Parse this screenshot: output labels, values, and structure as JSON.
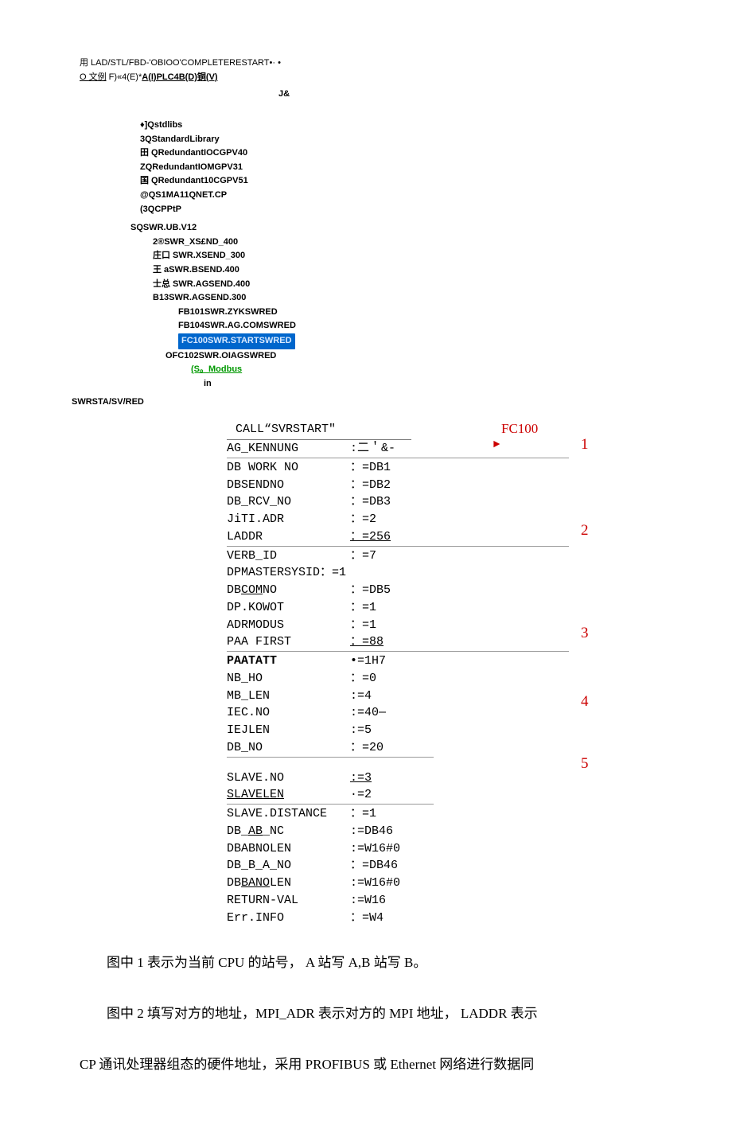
{
  "header": {
    "line1": "用 LAD/STL/FBD-'OBIOO'COMPLETERESTART•·  •",
    "line2_pre": "O 文例",
    "line2_mid": " F)«4(E)*",
    "line2_bold": "A(I)PLC4B(D)铜(V)",
    "jamp": "J&"
  },
  "tree": {
    "l1": "♦]Qstdlibs",
    "l2": "3QStandardLibrary",
    "l3": "田 QRedundantIOCGPV40",
    "l4": "ZQRedundantIOMGPV31",
    "l5": "国 QRedundant10CGPV51",
    "l6": "@QS1MA11QNET.CP",
    "l7": "(3QCPPtP",
    "l8": "SQSWR.UB.V12",
    "l9": "2®SWR_XS£ND_400",
    "l10": "庄口 SWR.XSEND_300",
    "l11": "王 aSWR.BSEND.400",
    "l12": "士总 SWR.AGSEND.400",
    "l13": "B13SWR.AGSEND.300",
    "l14": "FB101SWR.ZYKSWRED",
    "l15": "FB104SWR.AG.COMSWRED",
    "l16": "FC100SWR.STARTSWRED",
    "l17": "OFC102SWR.OIAGSWRED",
    "l18": "(S。Modbus",
    "l19": "in",
    "swr_line": "SWRSTA/SV/RED"
  },
  "code": {
    "fc100": "FC100",
    "call": "CALL“SVRSTART″",
    "rows": [
      {
        "name": "AG_KENNUNG",
        "val": ":二＇&-",
        "ann": "1",
        "arrow": true
      },
      {
        "name": "DB WORK NO",
        "val": "：=DB1"
      },
      {
        "name": "DBSENDNO",
        "val": "：=DB2"
      },
      {
        "name": "DB_RCV_NO",
        "val": "：=DB3"
      },
      {
        "name": "JiTI.ADR",
        "val": "：=2"
      },
      {
        "name": "LADDR",
        "val": "：=256",
        "ann": "2",
        "val_ul": true
      },
      {
        "name": "VERB_ID",
        "val": "：=7"
      },
      {
        "name": "DPMASTERSYSID：=1",
        "val": ""
      },
      {
        "name": "DBCOMNO",
        "val": "：=DB5",
        "name_ul_part": "COM"
      },
      {
        "name": "DP.KOWOT",
        "val": "：=1"
      },
      {
        "name": "ADRMODUS",
        "val": "：=1"
      },
      {
        "name": "PAA FIRST",
        "val": "：=88",
        "ann": "3",
        "val_ul": true
      },
      {
        "name": "PAATATT",
        "val": "•=1H7",
        "bold_name": true
      },
      {
        "name": "NB_HO",
        "val": "：=0"
      },
      {
        "name": "MB_LEN",
        "val": ":=4"
      },
      {
        "name": "IEC.NO",
        "val": ":=40—",
        "ann": "4"
      },
      {
        "name": "IEJLEN",
        "val": ":=5"
      },
      {
        "name": "DB_NO",
        "val": "：=20"
      },
      {
        "name": "SLAVE.NO",
        "val": ":=3",
        "ann": "5",
        "val_ul": true
      },
      {
        "name": "SLAVELEN",
        "val": "∙=2",
        "name_ul": true
      },
      {
        "name": "SLAVE.DISTANCE",
        "val": "：=1"
      },
      {
        "name": "DB_AB_NC",
        "val": ":=DB46",
        "name_ul_part": "AB"
      },
      {
        "name": "DBABNOLEN",
        "val": ":=W16#0"
      },
      {
        "name": "DB_B_A_NO",
        "val": "：=DB46"
      },
      {
        "name": "DBBANOLEN",
        "val": ":=W16#0",
        "name_ul_part": "BANO"
      },
      {
        "name": "RETURN-VAL",
        "val": ":=W16"
      },
      {
        "name": "Err.INFO",
        "val": "：=W4"
      }
    ]
  },
  "para": {
    "p1": "图中 1 表示为当前 CPU 的站号，   A 站写 A,B 站写 B。",
    "p2": "图中 2 填写对方的地址，MPI_ADR 表示对方的 MPI 地址，     LADDR 表示",
    "p3": "CP 通讯处理器组态的硬件地址，采用 PROFIBUS 或 Ethernet 网络进行数据同"
  }
}
